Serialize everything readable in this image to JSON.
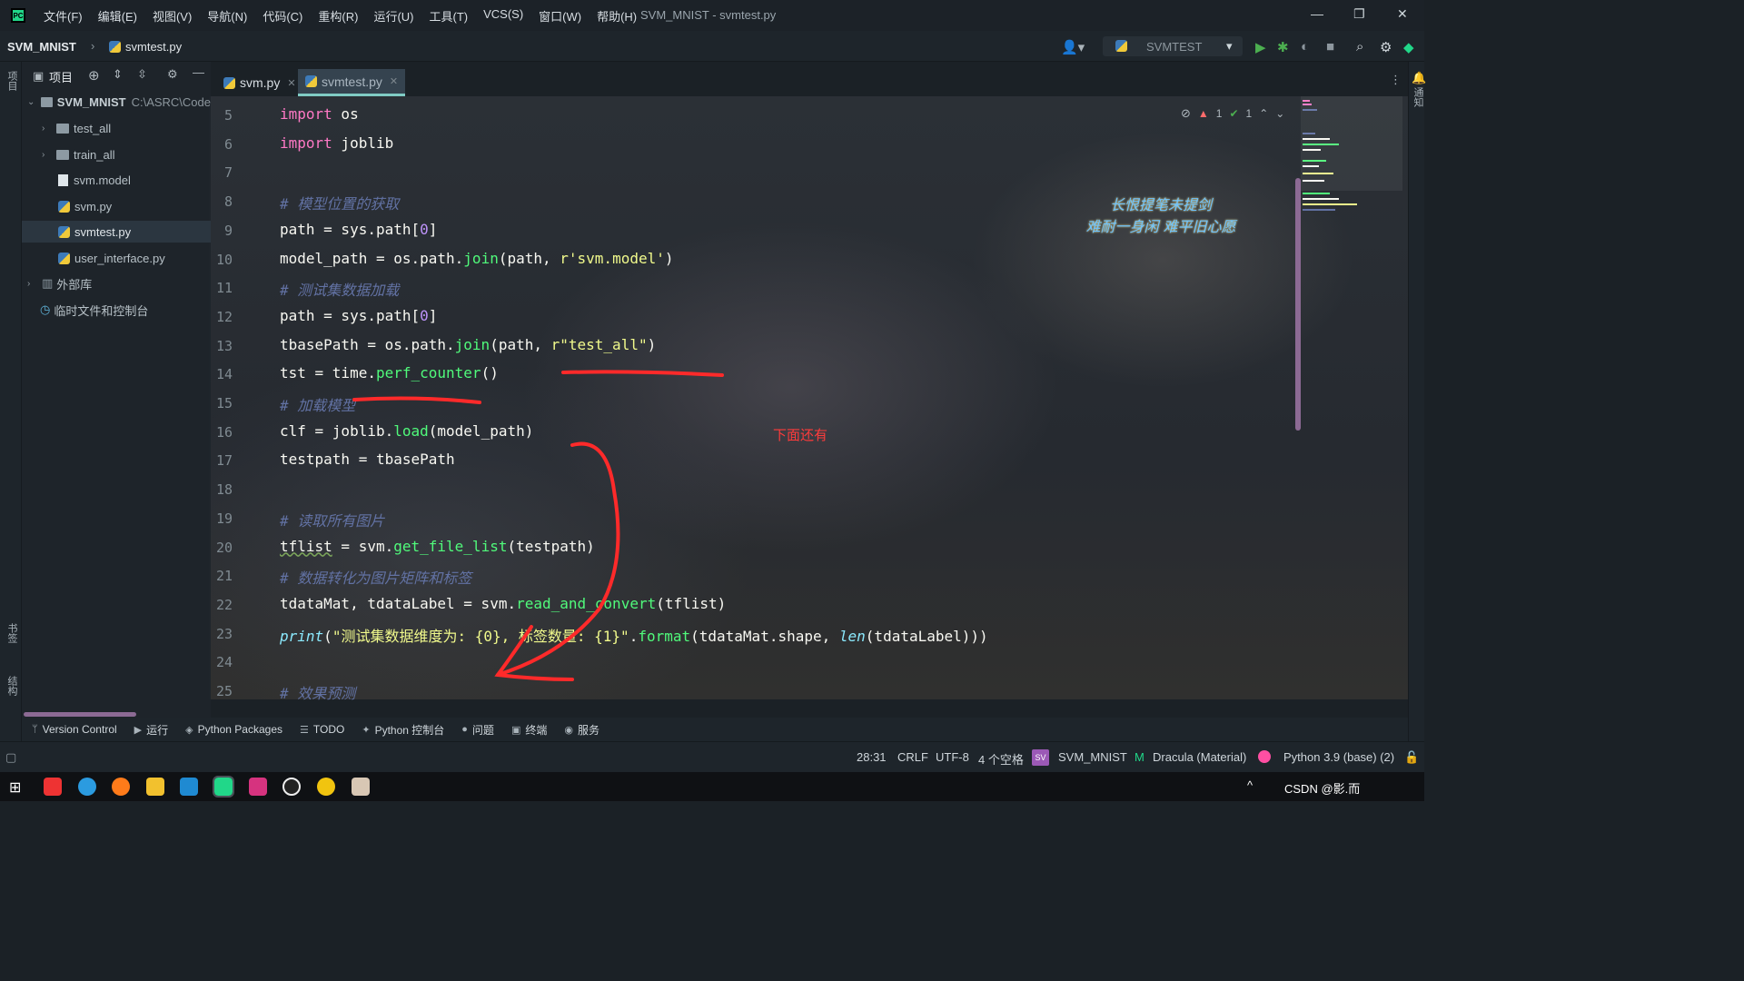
{
  "window": {
    "title": "SVM_MNIST - svmtest.py",
    "menu": [
      "文件(F)",
      "编辑(E)",
      "视图(V)",
      "导航(N)",
      "代码(C)",
      "重构(R)",
      "运行(U)",
      "工具(T)",
      "VCS(S)",
      "窗口(W)",
      "帮助(H)"
    ]
  },
  "navbar": {
    "project": "SVM_MNIST",
    "file": "svmtest.py",
    "run_config": "SVMTEST"
  },
  "project_panel": {
    "title": "项目",
    "root": {
      "name": "SVM_MNIST",
      "path": "C:\\ASRC\\Code"
    },
    "items": [
      {
        "label": "test_all",
        "type": "folder"
      },
      {
        "label": "train_all",
        "type": "folder"
      },
      {
        "label": "svm.model",
        "type": "file"
      },
      {
        "label": "svm.py",
        "type": "python"
      },
      {
        "label": "svmtest.py",
        "type": "python",
        "selected": true
      },
      {
        "label": "user_interface.py",
        "type": "python"
      },
      {
        "label": "外部库",
        "type": "library"
      },
      {
        "label": "临时文件和控制台",
        "type": "scratch"
      }
    ]
  },
  "left_stripe": {
    "top": "项目",
    "bottom1": "书签",
    "bottom2": "结构"
  },
  "right_stripe": {
    "label": "通知"
  },
  "tabs": [
    {
      "label": "svm.py",
      "active": false
    },
    {
      "label": "svmtest.py",
      "active": true
    }
  ],
  "inspections": {
    "warnings": "1",
    "ok": "1"
  },
  "code": {
    "line_numbers": [
      "5",
      "6",
      "7",
      "8",
      "9",
      "10",
      "11",
      "12",
      "13",
      "14",
      "15",
      "16",
      "17",
      "18",
      "19",
      "20",
      "21",
      "22",
      "23",
      "24",
      "25"
    ],
    "lines": [
      [
        [
          "kw",
          "import"
        ],
        [
          "plain",
          " os"
        ]
      ],
      [
        [
          "kw",
          "import"
        ],
        [
          "plain",
          " joblib"
        ]
      ],
      [],
      [
        [
          "cm",
          "# 模型位置的获取"
        ]
      ],
      [
        [
          "plain",
          "path = sys.path["
        ],
        [
          "num",
          "0"
        ],
        [
          "plain",
          "]"
        ]
      ],
      [
        [
          "plain",
          "model_path = os.path."
        ],
        [
          "fn",
          "join"
        ],
        [
          "plain",
          "(path, "
        ],
        [
          "str",
          "r'svm.model'"
        ],
        [
          "plain",
          ")"
        ]
      ],
      [
        [
          "cm",
          "# 测试集数据加载"
        ]
      ],
      [
        [
          "plain",
          "path = sys.path["
        ],
        [
          "num",
          "0"
        ],
        [
          "plain",
          "]"
        ]
      ],
      [
        [
          "plain",
          "tbasePath = os.path."
        ],
        [
          "fn",
          "join"
        ],
        [
          "plain",
          "(path, "
        ],
        [
          "str",
          "r\"test_all\""
        ],
        [
          "plain",
          ")"
        ]
      ],
      [
        [
          "plain",
          "tst = time."
        ],
        [
          "fn",
          "perf_counter"
        ],
        [
          "plain",
          "()"
        ]
      ],
      [
        [
          "cm",
          "# 加载模型"
        ]
      ],
      [
        [
          "plain",
          "clf = joblib."
        ],
        [
          "fn",
          "load"
        ],
        [
          "plain",
          "(model_path)"
        ]
      ],
      [
        [
          "plain",
          "testpath = tbasePath"
        ]
      ],
      [],
      [
        [
          "cm",
          "# 读取所有图片"
        ]
      ],
      [
        [
          "squig",
          "tflist"
        ],
        [
          "plain",
          " = svm."
        ],
        [
          "fn",
          "get_file_list"
        ],
        [
          "plain",
          "(testpath)"
        ]
      ],
      [
        [
          "cm",
          "# 数据转化为图片矩阵和标签"
        ]
      ],
      [
        [
          "plain",
          "tdataMat, tdataLabel = svm."
        ],
        [
          "fn",
          "read_and_convert"
        ],
        [
          "plain",
          "(tflist)"
        ]
      ],
      [
        [
          "bi",
          "print"
        ],
        [
          "plain",
          "("
        ],
        [
          "str",
          "\"测试集数据维度为: {0}, 标签数量: {1}\""
        ],
        [
          "plain",
          "."
        ],
        [
          "fn",
          "format"
        ],
        [
          "plain",
          "(tdataMat.shape, "
        ],
        [
          "bi",
          "len"
        ],
        [
          "plain",
          "(tdataLabel)))"
        ]
      ],
      [],
      [
        [
          "cm",
          "# 效果预测"
        ]
      ]
    ]
  },
  "overlays": {
    "poem_line1": "长恨提笔未提剑",
    "poem_line2": "难耐一身闲 难平旧心愿",
    "note": "下面还有"
  },
  "tool_windows": [
    "Version Control",
    "运行",
    "Python Packages",
    "TODO",
    "Python 控制台",
    "问题",
    "终端",
    "服务"
  ],
  "status": {
    "position": "28:31",
    "line_sep": "CRLF",
    "encoding": "UTF-8",
    "indent": "4 个空格",
    "project": "SVM_MNIST",
    "theme": "Dracula (Material)",
    "interpreter": "Python 3.9 (base) (2)"
  },
  "taskbar": {
    "tray_text": "CSDN @影.而"
  },
  "colors": {
    "accent": "#80cbc4",
    "comment": "#6272a4",
    "keyword": "#ff79c6",
    "function": "#50fa7b",
    "string": "#f1fa8c",
    "annotation_red": "#ff2a2a"
  }
}
